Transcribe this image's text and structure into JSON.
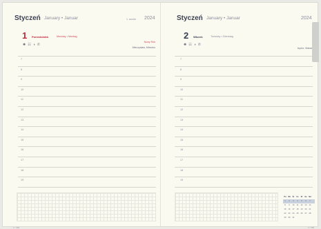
{
  "left_page": {
    "month": "Styczeń",
    "month_alt": "January • Januar",
    "week": "1. woche",
    "year": "2024",
    "day_number": "1",
    "day_name": "Poniedziałek",
    "day_alt": "Monday • Montag",
    "icons": [
      "sun-icon",
      "calendar-icon",
      "moon-icon",
      "phone-icon"
    ],
    "notes": [
      "Nowy Rok",
      "Mieczysław, Mieszko"
    ],
    "hours": [
      "7",
      "8",
      "9",
      "10",
      "11",
      "12",
      "13",
      "14",
      "15",
      "16",
      "17",
      "18",
      "19"
    ],
    "footer": "1 / 366"
  },
  "right_page": {
    "month": "Styczeń",
    "month_alt": "January • Januar",
    "year": "2024",
    "day_number": "2",
    "day_name": "Wtorek",
    "day_alt": "Tuesday • Dienstag",
    "icons": [
      "sun-icon",
      "calendar-icon",
      "moon-icon",
      "phone-icon"
    ],
    "notes": [
      "Izydor, Makary"
    ],
    "hours": [
      "7",
      "8",
      "9",
      "10",
      "11",
      "12",
      "13",
      "14",
      "15",
      "16",
      "17",
      "18",
      "19"
    ],
    "footer": "2 / 365",
    "mini_calendar": {
      "head": [
        "Pn",
        "Wt",
        "Śr",
        "Cz",
        "Pt",
        "So",
        "Nd"
      ],
      "rows": [
        [
          "1",
          "2",
          "3",
          "4",
          "5",
          "6",
          "7"
        ],
        [
          "8",
          "9",
          "10",
          "11",
          "12",
          "13",
          "14"
        ],
        [
          "15",
          "16",
          "17",
          "18",
          "19",
          "20",
          "21"
        ],
        [
          "22",
          "23",
          "24",
          "25",
          "26",
          "27",
          "28"
        ],
        [
          "29",
          "30",
          "31",
          "",
          "",
          "",
          ""
        ]
      ]
    }
  }
}
